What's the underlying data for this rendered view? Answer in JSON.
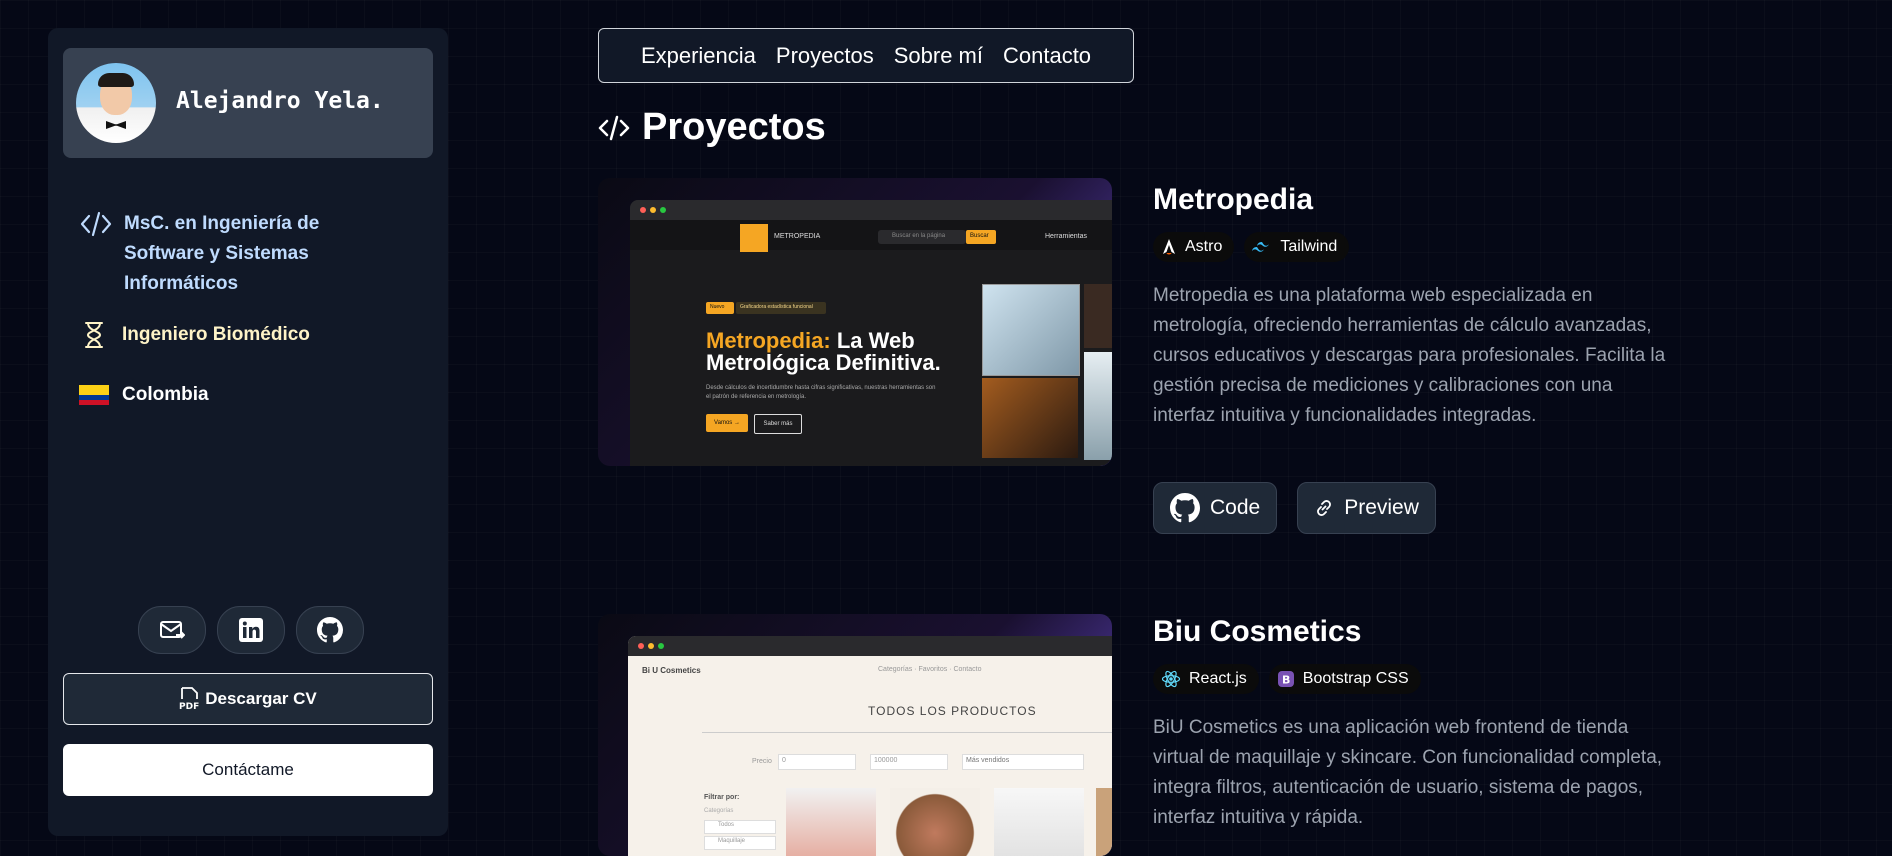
{
  "profile": {
    "name": "Alejandro Yela.",
    "degree": "MsC. en Ingeniería de Software y Sistemas Informáticos",
    "title": "Ingeniero Biomédico",
    "country": "Colombia"
  },
  "socials": [
    "mail-icon",
    "linkedin-icon",
    "github-icon"
  ],
  "buttons": {
    "cv": "Descargar CV",
    "contact": "Contáctame"
  },
  "nav": [
    "Experiencia",
    "Proyectos",
    "Sobre mí",
    "Contacto"
  ],
  "section": {
    "title": "Proyectos"
  },
  "projects": [
    {
      "title": "Metropedia",
      "tags": [
        "Astro",
        "Tailwind"
      ],
      "description": "Metropedia es una plataforma web especializada en metrología, ofreciendo herramientas de cálculo avanzadas, cursos educativos y descargas para profesionales. Facilita la gestión precisa de mediciones y calibraciones con una interfaz intuitiva y funcionalidades integradas.",
      "code_label": "Code",
      "preview_label": "Preview",
      "screenshot": {
        "brand": "METROPEDIA",
        "search_placeholder": "Buscar en la página",
        "search_button": "Buscar",
        "menu": "Herramientas",
        "tag1": "Nuevo",
        "tag2": "Graficadora estadística funcional",
        "headline_accent": "Metropedia:",
        "headline_rest": "La Web Metrológica Definitiva.",
        "sub": "Desde cálculos de incertidumbre hasta cifras significativas, nuestras herramientas son el patrón de referencia en metrología.",
        "btn1": "Vamos →",
        "btn2": "Saber más"
      }
    },
    {
      "title": "Biu Cosmetics",
      "tags": [
        "React.js",
        "Bootstrap CSS"
      ],
      "description": "BiU Cosmetics es una aplicación web frontend de tienda virtual de maquillaje y skincare. Con funcionalidad completa, integra filtros, autenticación de usuario, sistema de pagos, interfaz intuitiva y rápida.",
      "screenshot": {
        "brand": "Bi U Cosmetics",
        "nav": "Categorías · Favoritos · Contacto",
        "heading": "TODOS LOS PRODUCTOS",
        "price_label": "Precio",
        "price_min": "0",
        "price_max": "100000",
        "sort": "Más vendidos",
        "filter_title": "Filtrar por:",
        "categories_label": "Categorías",
        "cat1": "Todos",
        "cat2": "Maquillaje"
      }
    }
  ],
  "colors": {
    "accent_purple": "#6b4fd8",
    "metropedia_yellow": "#f5a623"
  }
}
